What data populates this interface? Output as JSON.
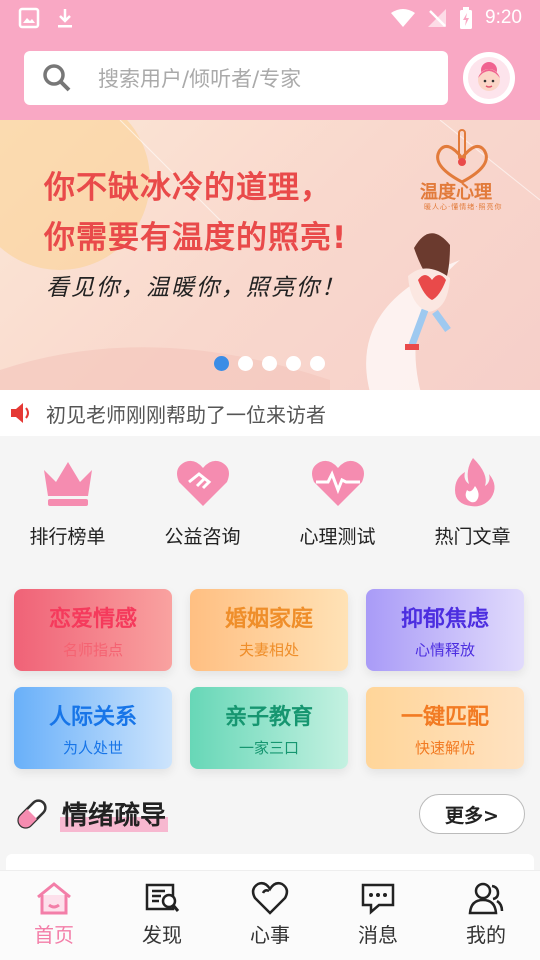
{
  "status_bar": {
    "time": "9:20"
  },
  "search": {
    "placeholder": "搜索用户/倾听者/专家"
  },
  "banner": {
    "slogan_line1": "你不缺冰冷的道理，",
    "slogan_line2": "你需要有温度的照亮!",
    "handwritten": "看见你，温暖你，照亮你！",
    "brand": "温度心理",
    "brand_sub": "暖人心·懂情绪·照亮你",
    "page_count": 5,
    "active_page": 1
  },
  "notice": {
    "text": "初见老师刚刚帮助了一位来访者"
  },
  "quick_entries": [
    {
      "label": "排行榜单",
      "icon": "crown-icon"
    },
    {
      "label": "公益咨询",
      "icon": "handshake-icon"
    },
    {
      "label": "心理测试",
      "icon": "heartbeat-icon"
    },
    {
      "label": "热门文章",
      "icon": "flame-icon"
    }
  ],
  "categories": [
    {
      "title": "恋爱情感",
      "subtitle": "名师指点"
    },
    {
      "title": "婚姻家庭",
      "subtitle": "夫妻相处"
    },
    {
      "title": "抑郁焦虑",
      "subtitle": "心情释放"
    },
    {
      "title": "人际关系",
      "subtitle": "为人处世"
    },
    {
      "title": "亲子教育",
      "subtitle": "一家三口"
    },
    {
      "title": "一键匹配",
      "subtitle": "快速解忧"
    }
  ],
  "section": {
    "title": "情绪疏导",
    "more": "更多>"
  },
  "tabs": [
    {
      "label": "首页",
      "icon": "home-icon",
      "active": true
    },
    {
      "label": "发现",
      "icon": "discover-icon",
      "active": false
    },
    {
      "label": "心事",
      "icon": "heart-icon",
      "active": false
    },
    {
      "label": "消息",
      "icon": "message-icon",
      "active": false
    },
    {
      "label": "我的",
      "icon": "user-icon",
      "active": false
    }
  ],
  "colors": {
    "header": "#f9a8c4",
    "active_tab": "#f37ea8",
    "accent_dot": "#3b8de6"
  }
}
